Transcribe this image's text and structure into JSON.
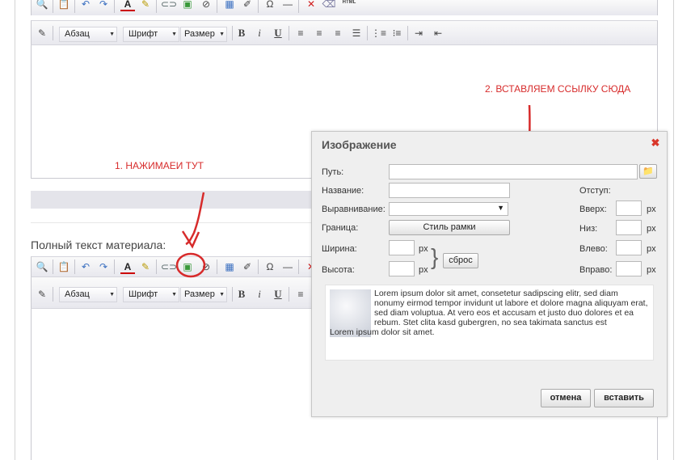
{
  "toolbar": {
    "paragraph": "Абзац",
    "font": "Шрифт",
    "size": "Размер",
    "bold": "B",
    "italic": "i",
    "underline": "U",
    "omega": "Ω",
    "html": "HTML"
  },
  "editor2_label": "Полный текст материала:",
  "annotations": {
    "step1": "1. НАЖИМАЕИ ТУТ",
    "step2": "2. ВСТАВЛЯЕМ ССЫЛКУ СЮДА"
  },
  "dialog": {
    "title": "Изображение",
    "path_label": "Путь:",
    "path_value": "",
    "name_label": "Название:",
    "name_value": "",
    "align_label": "Выравнивание:",
    "align_value": "",
    "border_label": "Граница:",
    "border_button": "Стиль рамки",
    "width_label": "Ширина:",
    "height_label": "Высота:",
    "px": "px",
    "reset_button": "сброс",
    "indent_label": "Отступ:",
    "top_label": "Вверх:",
    "bottom_label": "Низ:",
    "left_label": "Влево:",
    "right_label": "Вправо:",
    "preview_text": "Lorem ipsum dolor sit amet, consetetur sadipscing elitr, sed diam nonumy eirmod tempor invidunt ut labore et dolore magna aliquyam erat, sed diam voluptua. At vero eos et accusam et justo duo dolores et ea rebum. Stet clita kasd gubergren, no sea takimata sanctus est",
    "preview_text2": "Lorem ipsum dolor sit amet.",
    "cancel_button": "отмена",
    "insert_button": "вставить"
  },
  "colors": {
    "annotation": "#d72b2b",
    "close": "#d9362a"
  },
  "icons": [
    "find-icon",
    "paste-icon",
    "undo-icon",
    "redo-icon",
    "text-color-icon",
    "highlight-icon",
    "link-icon",
    "image-icon",
    "unlink-icon",
    "table-icon",
    "edit-table-icon",
    "special-char-icon",
    "horizontal-rule-icon",
    "remove-format-icon",
    "cleanup-icon",
    "html-source-icon",
    "edit-icon",
    "align-left-icon",
    "align-center-icon",
    "align-right-icon",
    "justify-icon",
    "ordered-list-icon",
    "unordered-list-icon",
    "indent-icon",
    "outdent-icon",
    "browse-folder-icon",
    "close-icon"
  ]
}
